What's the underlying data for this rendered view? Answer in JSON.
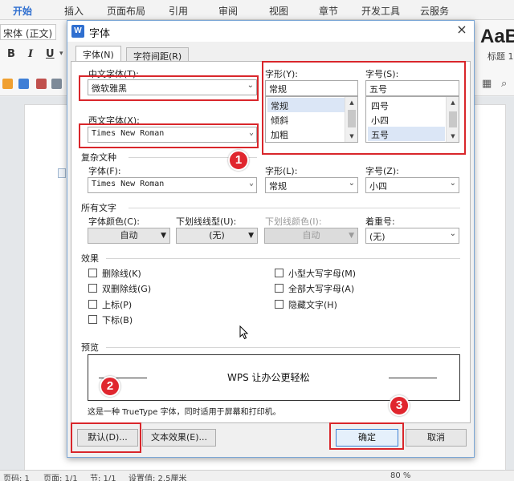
{
  "ribbon": {
    "tabs": [
      "开始",
      "插入",
      "页面布局",
      "引用",
      "审阅",
      "视图",
      "章节",
      "开发工具",
      "云服务"
    ],
    "active_tab": "开始",
    "font_name": "宋体 (正文)",
    "format_buttons": [
      "B",
      "I",
      "U"
    ],
    "style_sample": "AaB",
    "style_name": "标题 1"
  },
  "dialog": {
    "title": "字体",
    "close_glyph": "×",
    "tabs": [
      "字体(N)",
      "字符间距(R)"
    ],
    "active_tab": "字体(N)",
    "chinese_font_label": "中文字体(T):",
    "chinese_font_value": "微软雅黑",
    "western_font_label": "西文字体(X):",
    "western_font_value": "Times New Roman",
    "style_label": "字形(Y):",
    "style_value": "常规",
    "style_options": [
      "常规",
      "倾斜",
      "加粗"
    ],
    "style_selected": "常规",
    "size_label": "字号(S):",
    "size_value": "五号",
    "size_options": [
      "四号",
      "小四",
      "五号"
    ],
    "size_selected": "五号",
    "complex": {
      "header": "复杂文种",
      "font_label": "字体(F):",
      "font_value": "Times New Roman",
      "style_label": "字形(L):",
      "style_value": "常规",
      "size_label": "字号(Z):",
      "size_value": "小四"
    },
    "all_text": {
      "header": "所有文字",
      "color_label": "字体颜色(C):",
      "color_value": "自动",
      "underline_label": "下划线线型(U):",
      "underline_value": "(无)",
      "underline_color_label": "下划线颜色(I):",
      "underline_color_value": "自动",
      "emphasis_label": "着重号:",
      "emphasis_value": "(无)"
    },
    "effects": {
      "header": "效果",
      "left": [
        "删除线(K)",
        "双删除线(G)",
        "上标(P)",
        "下标(B)"
      ],
      "right": [
        "小型大写字母(M)",
        "全部大写字母(A)",
        "隐藏文字(H)"
      ]
    },
    "preview": {
      "header": "预览",
      "text": "WPS 让办公更轻松",
      "note": "这是一种 TrueType 字体，同时适用于屏幕和打印机。"
    },
    "buttons": {
      "default": "默认(D)...",
      "text_effect": "文本效果(E)...",
      "ok": "确定",
      "cancel": "取消"
    }
  },
  "annotations": {
    "badges": [
      "1",
      "2",
      "3"
    ],
    "highlight_color": "#d9262b",
    "badge_color": "#e0262e"
  },
  "statusbar": {
    "page_code": "页码: 1",
    "page": "页面: 1/1",
    "section": "节: 1/1",
    "setting": "设置值: 2.5厘米",
    "zoom": "80 %"
  },
  "colors": {
    "accent": "#2f6fd0",
    "dialog_bg": "#f0f0f0"
  }
}
